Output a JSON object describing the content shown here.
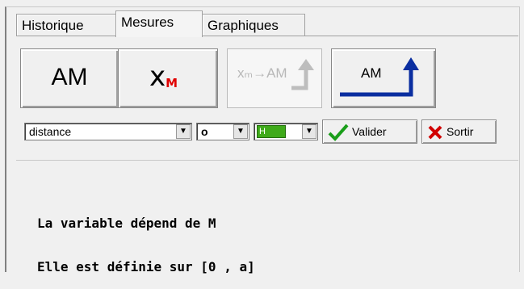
{
  "tabs": [
    {
      "label": "Historique",
      "active": false
    },
    {
      "label": "Mesures",
      "active": true
    },
    {
      "label": "Graphiques",
      "active": false
    }
  ],
  "toolbar": {
    "am_label": "AM",
    "xm_label": "x",
    "xm_subscript": "M",
    "xm_to_am_label": "xₘ→AM",
    "am_up_label": "AM"
  },
  "controls": {
    "variable_select": "distance",
    "letter_select": "o",
    "color_label": "H",
    "validate_label": "Valider",
    "exit_label": "Sortir"
  },
  "message": {
    "line1": "La variable dépend de M",
    "line2": "Elle est définie sur [0 , a]"
  },
  "colors": {
    "accent_red": "#e00000",
    "check_green": "#1a9e1a",
    "arrow_blue": "#0a2ea0",
    "swatch_green": "#3faa1a"
  }
}
